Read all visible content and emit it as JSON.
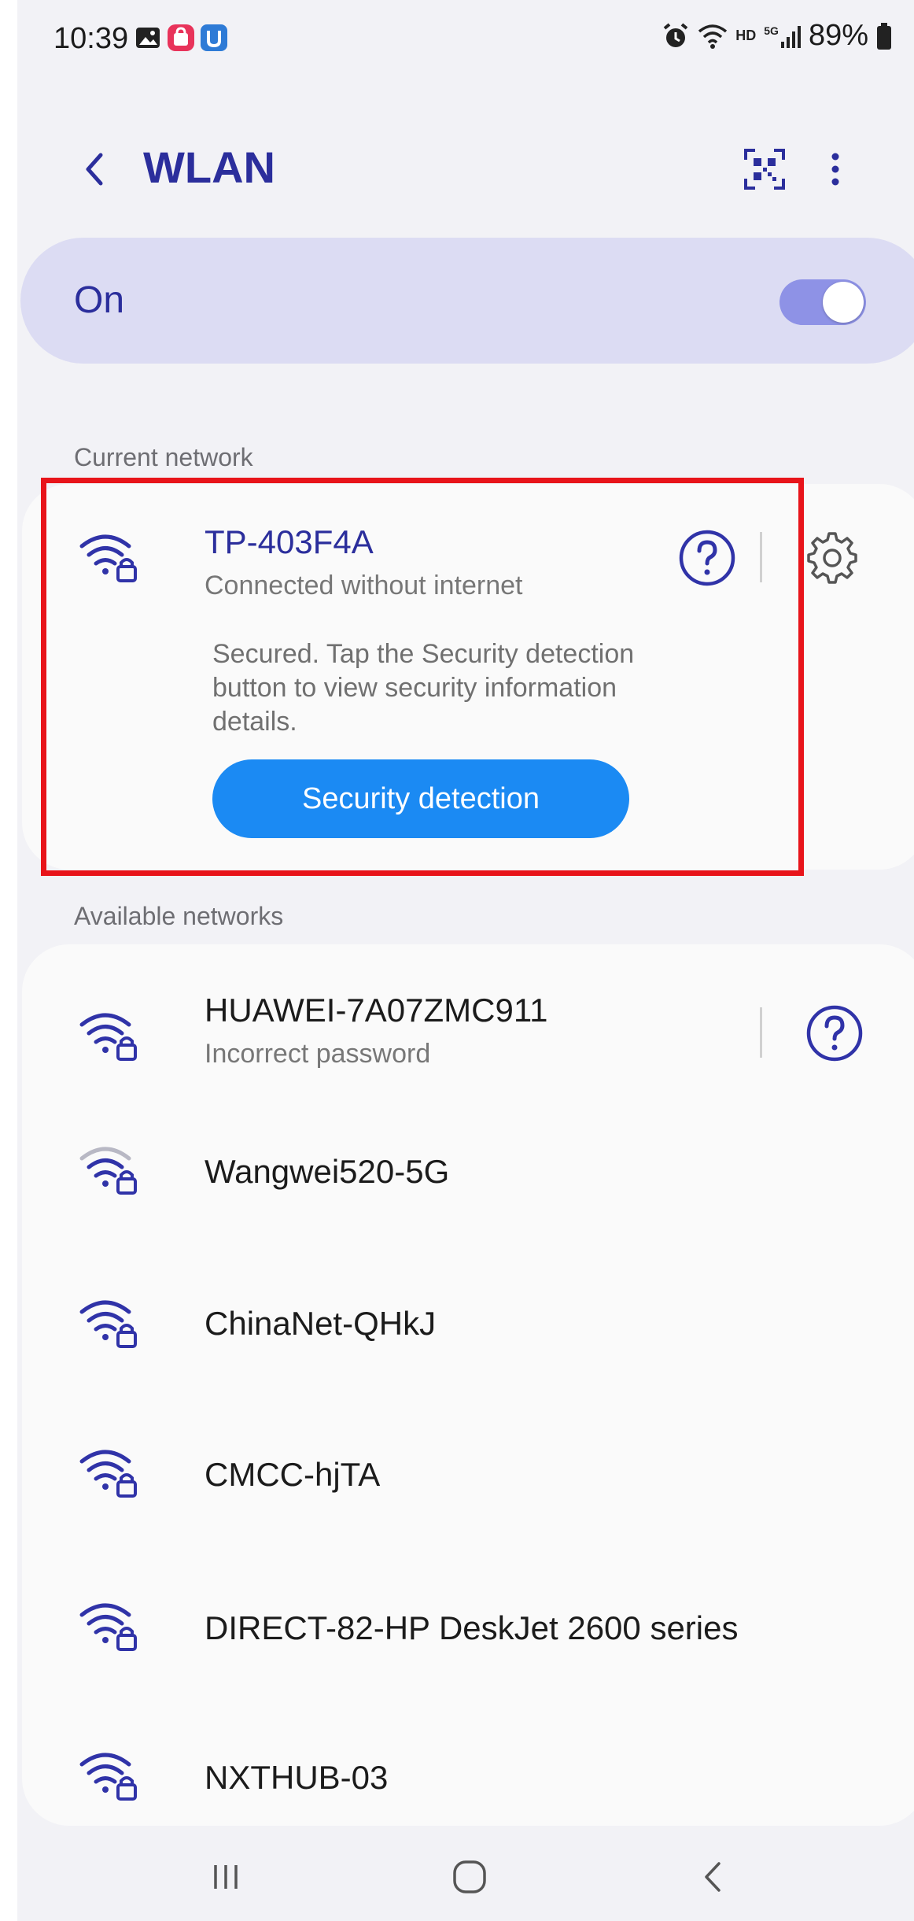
{
  "status_bar": {
    "time": "10:39",
    "battery_text": "89%",
    "icons": [
      "gallery-notification-icon",
      "shopping-notification-icon",
      "app-notification-icon",
      "alarm-icon",
      "wifi-status-icon",
      "hd-voice-icon",
      "5g-signal-icon",
      "battery-icon"
    ],
    "hd_label": "HD",
    "net_label": "5G"
  },
  "header": {
    "title": "WLAN",
    "back_icon": "chevron-left-icon",
    "qr_icon": "qr-scan-icon",
    "more_icon": "more-vertical-icon"
  },
  "wlan_toggle": {
    "label": "On",
    "enabled": true
  },
  "current_network": {
    "section_label": "Current network",
    "name": "TP-403F4A",
    "status": "Connected without internet",
    "description": "Secured. Tap the Security detection button to view security information details.",
    "button_label": "Security detection"
  },
  "available_networks": {
    "section_label": "Available networks",
    "items": [
      {
        "name": "HUAWEI-7A07ZMC911",
        "status": "Incorrect password",
        "signal": "strong",
        "has_help": true
      },
      {
        "name": "Wangwei520-5G",
        "status": "",
        "signal": "weak",
        "has_help": false
      },
      {
        "name": "ChinaNet-QHkJ",
        "status": "",
        "signal": "strong",
        "has_help": false
      },
      {
        "name": "CMCC-hjTA",
        "status": "",
        "signal": "strong",
        "has_help": false
      },
      {
        "name": "DIRECT-82-HP DeskJet 2600 series",
        "status": "",
        "signal": "strong",
        "has_help": false
      },
      {
        "name": "NXTHUB-03",
        "status": "",
        "signal": "strong",
        "has_help": false
      }
    ]
  },
  "colors": {
    "accent": "#2b2e9c",
    "toggle_card": "#dcdcf3",
    "button_blue": "#1b8af3",
    "highlight_red": "#e8141a",
    "background": "#f2f2f6"
  },
  "nav_bar": {
    "recents_icon": "recents-icon",
    "home_icon": "home-icon",
    "back_icon": "back-icon"
  }
}
